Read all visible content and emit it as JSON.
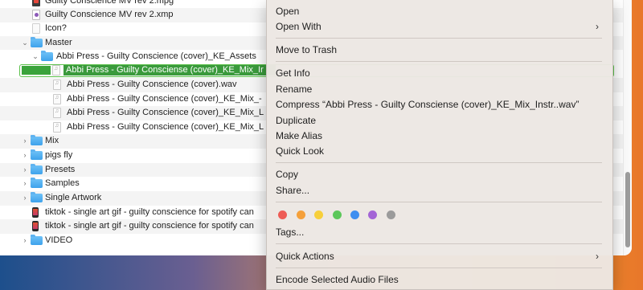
{
  "finder": {
    "rows": [
      {
        "label": "Guilty Conscience MV rev 2.mpg",
        "icon": "video-file-icon"
      },
      {
        "label": "Guilty Conscience MV rev 2.xmp",
        "icon": "xmp-file-icon"
      },
      {
        "label": "Icon?",
        "icon": "blank-file-icon"
      },
      {
        "label": "Master",
        "icon": "folder-icon"
      },
      {
        "label": "Abbi Press - Guilty Conscience (cover)_KE_Assets",
        "icon": "folder-icon"
      },
      {
        "label": "Abbi Press - Guilty Consciense (cover)_KE_Mix_Instr..wav",
        "icon": "audio-file-icon"
      },
      {
        "label": "Abbi Press - Guilty Conscience (cover).wav",
        "icon": "audio-file-icon"
      },
      {
        "label": "Abbi Press - Guilty Conscience (cover)_KE_Mix_-",
        "icon": "audio-file-icon"
      },
      {
        "label": "Abbi Press - Guilty Conscience (cover)_KE_Mix_L",
        "icon": "audio-file-icon"
      },
      {
        "label": "Abbi Press - Guilty Conscience (cover)_KE_Mix_L",
        "icon": "audio-file-icon"
      },
      {
        "label": "Mix",
        "icon": "folder-icon"
      },
      {
        "label": "pigs fly",
        "icon": "folder-icon"
      },
      {
        "label": "Presets",
        "icon": "folder-icon"
      },
      {
        "label": "Samples",
        "icon": "folder-icon"
      },
      {
        "label": "Single Artwork",
        "icon": "folder-icon"
      },
      {
        "label": "tiktok - single art gif - guilty conscience for spotify can",
        "icon": "phone-video-icon"
      },
      {
        "label": "tiktok - single art gif - guilty conscience for spotify can",
        "icon": "phone-video-icon"
      },
      {
        "label": "VIDEO",
        "icon": "folder-icon"
      }
    ],
    "editing_label": "Abbi Press - Guilty Consciense (cover)_KE_Mix_Ir"
  },
  "menu": {
    "open": "Open",
    "open_with": "Open With",
    "move_to_trash": "Move to Trash",
    "get_info": "Get Info",
    "rename": "Rename",
    "compress": "Compress “Abbi Press - Guilty Consciense (cover)_KE_Mix_Instr..wav”",
    "duplicate": "Duplicate",
    "make_alias": "Make Alias",
    "quick_look": "Quick Look",
    "copy": "Copy",
    "share": "Share...",
    "tags": "Tags...",
    "quick_actions": "Quick Actions",
    "encode": "Encode Selected Audio Files",
    "submenu_arrow": "›"
  },
  "tag_colors": [
    "#ee5c55",
    "#f5a03a",
    "#f7cf3a",
    "#5cc75a",
    "#3d8ef0",
    "#a465d6",
    "#9b9b9b"
  ],
  "tag_names": [
    "red-tag",
    "orange-tag",
    "yellow-tag",
    "green-tag",
    "blue-tag",
    "purple-tag",
    "gray-tag"
  ]
}
